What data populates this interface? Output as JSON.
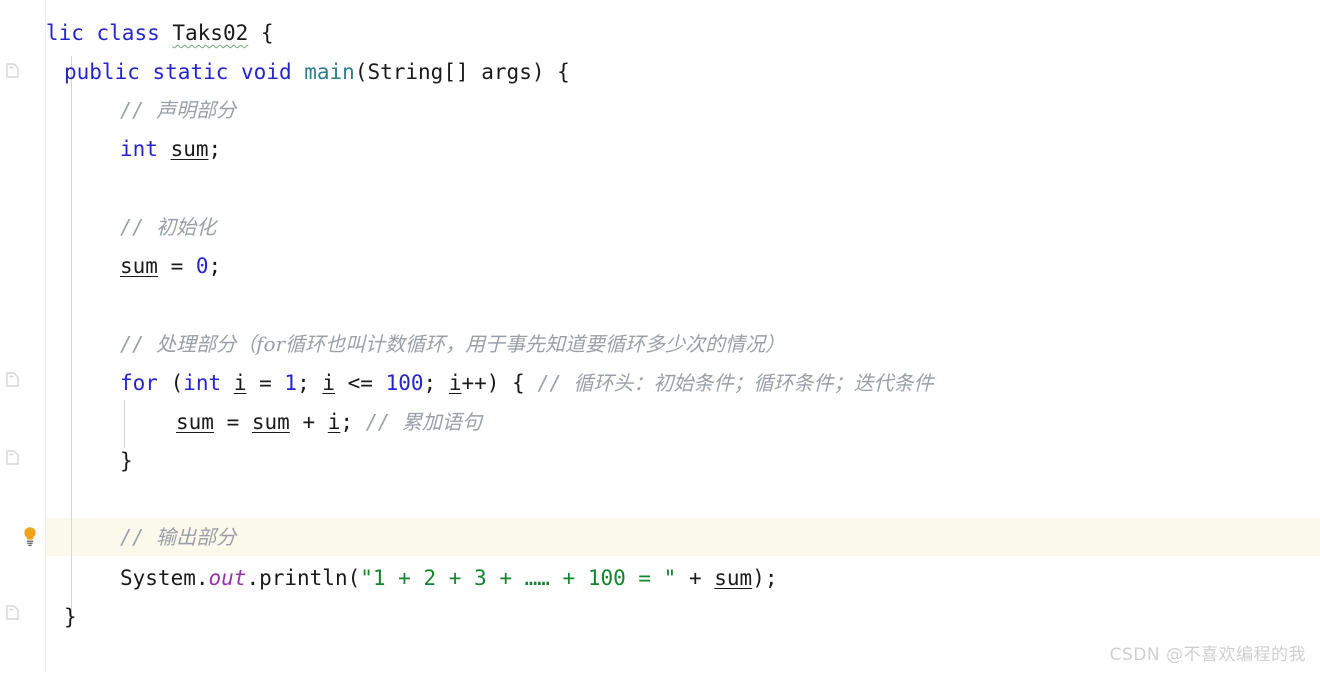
{
  "editor": {
    "language": "java",
    "background_color": "#ffffff",
    "current_line_highlight_color": "#fbf8ec",
    "gutter_border_color": "#eceff1",
    "indent_guide_color": "#d4d4d4"
  },
  "theme_colors": {
    "keyword": "#2525cc",
    "number": "#2525cc",
    "string": "#13862b",
    "comment": "#9aa0a6",
    "method_declaration": "#2e7d8f",
    "static_field": "#9b30b0",
    "identifier": "#1a1a1a",
    "typo_underline": "#7ba77b",
    "lightbulb": "#f0a318"
  },
  "gutter": {
    "fold_icons": [
      {
        "name": "fold-arrow-class-body",
        "line": 2
      },
      {
        "name": "fold-arrow-for-body",
        "line": 9
      },
      {
        "name": "fold-arrow-method-end",
        "line": 11
      },
      {
        "name": "fold-arrow-file-end",
        "line": 14
      }
    ],
    "lightbulb": {
      "name": "intention-bulb-icon",
      "tooltip": "Show Context Actions",
      "line": 13
    }
  },
  "code": {
    "line01": {
      "tokens": [
        {
          "cls": "kw",
          "text": "public "
        },
        {
          "cls": "kw",
          "text": "class "
        },
        {
          "cls": "typo",
          "text": "Taks02"
        },
        {
          "cls": "plain",
          "text": " {"
        }
      ]
    },
    "line02": {
      "tokens": [
        {
          "cls": "kw",
          "text": "public "
        },
        {
          "cls": "kw",
          "text": "static "
        },
        {
          "cls": "kw",
          "text": "void "
        },
        {
          "cls": "method",
          "text": "main"
        },
        {
          "cls": "plain",
          "text": "(String[] args) {"
        }
      ]
    },
    "line03": {
      "tokens": [
        {
          "cls": "cmt cmt-slash",
          "text": "// "
        },
        {
          "cls": "cmt",
          "text": "声明部分"
        }
      ]
    },
    "line04": {
      "tokens": [
        {
          "cls": "kw",
          "text": "int "
        },
        {
          "cls": "local",
          "text": "sum"
        },
        {
          "cls": "plain",
          "text": ";"
        }
      ]
    },
    "line06": {
      "tokens": [
        {
          "cls": "cmt cmt-slash",
          "text": "// "
        },
        {
          "cls": "cmt",
          "text": "初始化"
        }
      ]
    },
    "line07": {
      "tokens": [
        {
          "cls": "local",
          "text": "sum"
        },
        {
          "cls": "plain",
          "text": " = "
        },
        {
          "cls": "num",
          "text": "0"
        },
        {
          "cls": "plain",
          "text": ";"
        }
      ]
    },
    "line09": {
      "tokens": [
        {
          "cls": "cmt cmt-slash",
          "text": "// "
        },
        {
          "cls": "cmt",
          "text": "处理部分（for循环也叫计数循环，用于事先知道要循环多少次的情况）"
        }
      ]
    },
    "line10": {
      "tokens": [
        {
          "cls": "kw",
          "text": "for "
        },
        {
          "cls": "plain",
          "text": "("
        },
        {
          "cls": "kw",
          "text": "int "
        },
        {
          "cls": "local",
          "text": "i"
        },
        {
          "cls": "plain",
          "text": " = "
        },
        {
          "cls": "num",
          "text": "1"
        },
        {
          "cls": "plain",
          "text": "; "
        },
        {
          "cls": "local",
          "text": "i"
        },
        {
          "cls": "plain",
          "text": " <= "
        },
        {
          "cls": "num",
          "text": "100"
        },
        {
          "cls": "plain",
          "text": "; "
        },
        {
          "cls": "local",
          "text": "i"
        },
        {
          "cls": "plain",
          "text": "++) { "
        },
        {
          "cls": "cmt cmt-slash",
          "text": "// "
        },
        {
          "cls": "cmt",
          "text": "循环头：初始条件；循环条件；迭代条件"
        }
      ]
    },
    "line11": {
      "tokens": [
        {
          "cls": "local",
          "text": "sum"
        },
        {
          "cls": "plain",
          "text": " = "
        },
        {
          "cls": "local",
          "text": "sum"
        },
        {
          "cls": "plain",
          "text": " + "
        },
        {
          "cls": "local",
          "text": "i"
        },
        {
          "cls": "plain",
          "text": "; "
        },
        {
          "cls": "cmt cmt-slash",
          "text": "// "
        },
        {
          "cls": "cmt",
          "text": "累加语句"
        }
      ]
    },
    "line12": {
      "tokens": [
        {
          "cls": "plain",
          "text": "}"
        }
      ]
    },
    "line14": {
      "tokens": [
        {
          "cls": "cmt cmt-slash",
          "text": "// "
        },
        {
          "cls": "cmt",
          "text": "输出部分"
        }
      ]
    },
    "line15": {
      "tokens": [
        {
          "cls": "plain",
          "text": "System."
        },
        {
          "cls": "staticfld",
          "text": "out"
        },
        {
          "cls": "plain",
          "text": ".println("
        },
        {
          "cls": "str",
          "text": "\"1 + 2 + 3 + …… + 100 = \""
        },
        {
          "cls": "plain",
          "text": " + "
        },
        {
          "cls": "local",
          "text": "sum"
        },
        {
          "cls": "plain",
          "text": ");"
        }
      ]
    },
    "line16": {
      "tokens": [
        {
          "cls": "plain",
          "text": "}"
        }
      ]
    },
    "line17": {
      "tokens": [
        {
          "cls": "plain",
          "text": "}"
        }
      ]
    }
  },
  "watermark": {
    "text": "CSDN @不喜欢编程的我"
  }
}
